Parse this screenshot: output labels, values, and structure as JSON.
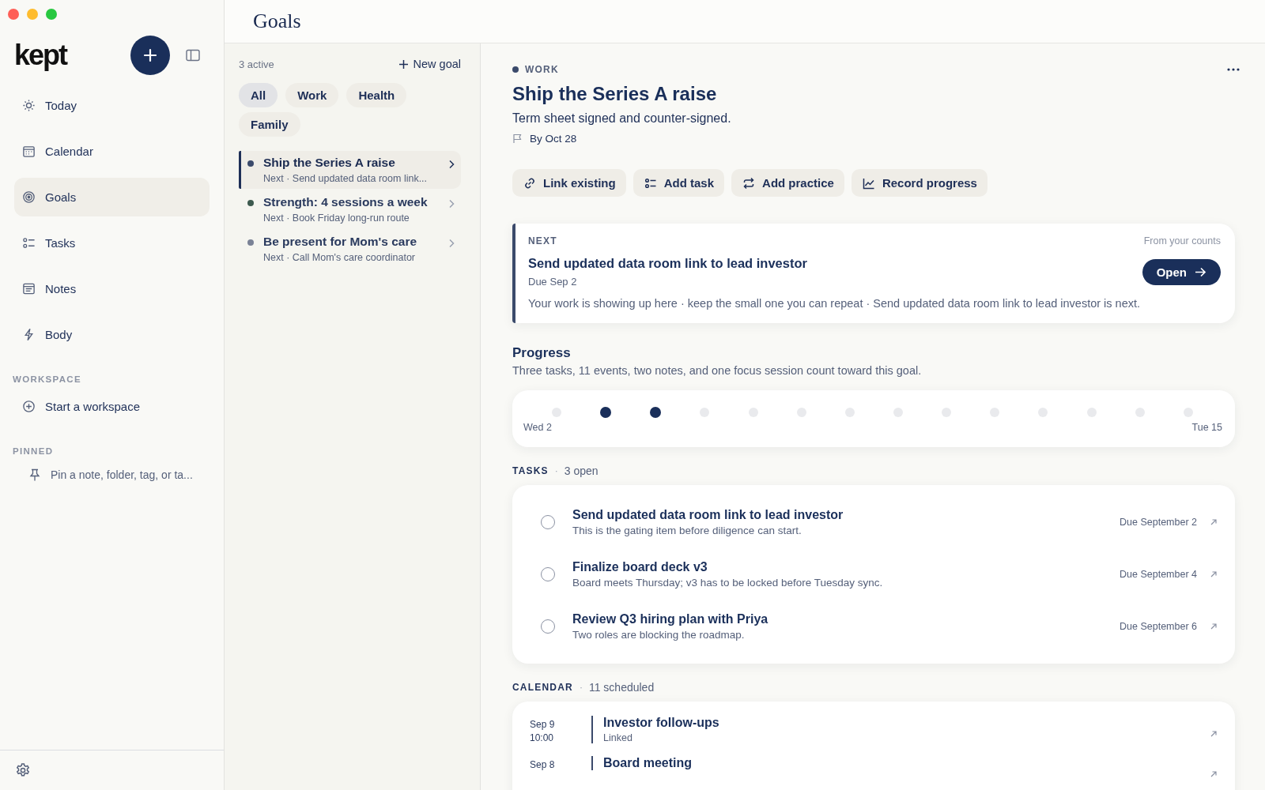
{
  "sidebar": {
    "logo": "kept",
    "nav": [
      {
        "label": "Today",
        "selected": false
      },
      {
        "label": "Calendar",
        "selected": false
      },
      {
        "label": "Goals",
        "selected": true
      },
      {
        "label": "Tasks",
        "selected": false
      },
      {
        "label": "Notes",
        "selected": false
      },
      {
        "label": "Body",
        "selected": false
      }
    ],
    "workspace": {
      "heading": "WORKSPACE",
      "action": "Start a workspace"
    },
    "pinned": {
      "heading": "PINNED",
      "placeholder": "Pin a note, folder, tag, or ta..."
    }
  },
  "page_title": "Goals",
  "goal_list": {
    "count": "3 active",
    "new_button": "New goal",
    "filters": [
      {
        "label": "All",
        "selected": true
      },
      {
        "label": "Work",
        "selected": false
      },
      {
        "label": "Health",
        "selected": false
      },
      {
        "label": "Family",
        "selected": false
      }
    ],
    "goals": [
      {
        "title": "Ship the Series A raise",
        "next": "Next · Send updated data room link...",
        "color": "#3b4a6b",
        "selected": true
      },
      {
        "title": "Strength: 4 sessions a week",
        "next": "Next · Book Friday long-run route",
        "color": "#3d5a4f",
        "selected": false
      },
      {
        "title": "Be present for Mom's care",
        "next": "Next · Call Mom's care coordinator",
        "color": "#7a8296",
        "selected": false
      }
    ]
  },
  "detail": {
    "category": "WORK",
    "title": "Ship the Series A raise",
    "outcome": "Term sheet signed and counter-signed.",
    "deadline": "By Oct 28",
    "actions": [
      "Link existing",
      "Add task",
      "Add practice",
      "Record progress"
    ],
    "next_card": {
      "label": "NEXT",
      "source": "From your counts",
      "title": "Send updated data room link to lead investor",
      "due": "Due Sep 2",
      "button": "Open",
      "message": "Your work is showing up here · keep the small one you can repeat · Send updated data room link to lead investor is next."
    },
    "progress": {
      "heading": "Progress",
      "description": "Three tasks, 11 events, two notes, and one focus session count toward this goal.",
      "start": "Wed 2",
      "end": "Tue 15",
      "days": [
        {
          "on": false
        },
        {
          "on": true
        },
        {
          "on": true
        },
        {
          "on": false
        },
        {
          "on": false
        },
        {
          "on": false
        },
        {
          "on": false
        },
        {
          "on": false
        },
        {
          "on": false
        },
        {
          "on": false
        },
        {
          "on": false
        },
        {
          "on": false
        },
        {
          "on": false
        },
        {
          "on": false
        }
      ]
    },
    "tasks": {
      "heading": "TASKS",
      "separator": "·",
      "count": "3 open",
      "items": [
        {
          "title": "Send updated data room link to lead investor",
          "note": "This is the gating item before diligence can start.",
          "due": "Due September 2",
          "checked": false
        },
        {
          "title": "Finalize board deck v3",
          "note": "Board meets Thursday; v3 has to be locked before Tuesday sync.",
          "due": "Due September 4",
          "checked": false
        },
        {
          "title": "Review Q3 hiring plan with Priya",
          "note": "Two roles are blocking the roadmap.",
          "due": "Due September 6",
          "checked": false
        }
      ]
    },
    "calendar": {
      "heading": "CALENDAR",
      "separator": "·",
      "count": "11 scheduled",
      "events": [
        {
          "date": "Sep 9",
          "time": "10:00",
          "title": "Investor follow-ups",
          "status": "Linked"
        },
        {
          "date": "Sep 8",
          "title": "Board meeting"
        }
      ]
    }
  }
}
